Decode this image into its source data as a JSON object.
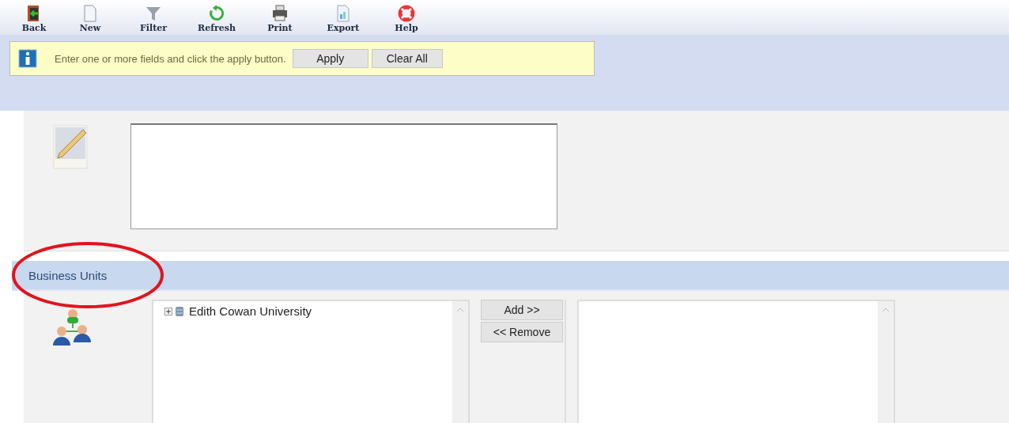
{
  "toolbar": [
    {
      "label": "Back",
      "kind": "back"
    },
    {
      "label": "New",
      "kind": "new"
    },
    {
      "label": "Filter",
      "kind": "filter"
    },
    {
      "label": "Refresh",
      "kind": "refresh"
    },
    {
      "label": "Print",
      "kind": "print"
    },
    {
      "label": "Export",
      "kind": "export"
    },
    {
      "label": "Help",
      "kind": "help"
    }
  ],
  "info": {
    "message": "Enter one or more fields and click the apply button.",
    "buttons": [
      "Apply",
      "Clear All"
    ]
  },
  "business_units": {
    "title": "Business Units",
    "circled": true,
    "available": [
      {
        "label": "Edith Cowan University",
        "expanded": false
      }
    ],
    "buttons": [
      "Add >>",
      "<< Remove"
    ]
  }
}
